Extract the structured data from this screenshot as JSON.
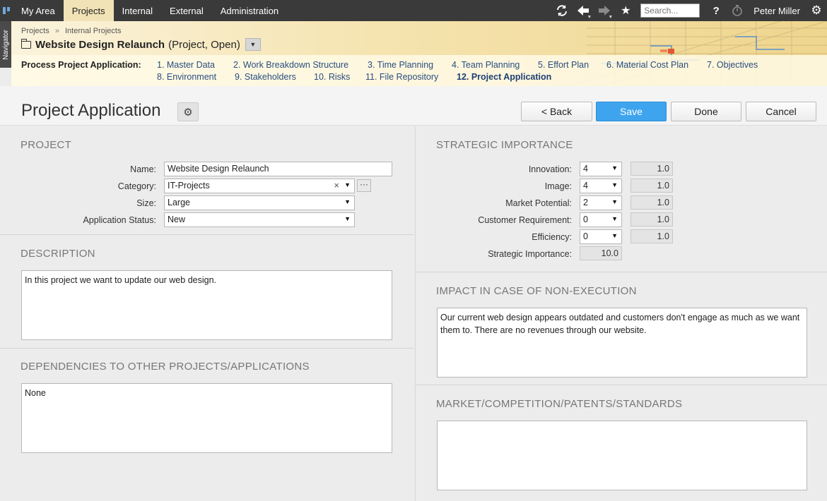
{
  "topnav": {
    "tabs": [
      {
        "label": "My Area"
      },
      {
        "label": "Projects"
      },
      {
        "label": "Internal"
      },
      {
        "label": "External"
      },
      {
        "label": "Administration"
      }
    ],
    "search_placeholder": "Search...",
    "help_label": "?",
    "user_name": "Peter Miller"
  },
  "navigator_label": "Navigator",
  "breadcrumb": {
    "items": [
      "Projects",
      "Internal Projects"
    ],
    "separator": "»"
  },
  "project": {
    "name": "Website Design Relaunch",
    "state": "(Project, Open)"
  },
  "process": {
    "label": "Process Project Application:",
    "steps": [
      {
        "label": "1. Master Data"
      },
      {
        "label": "2. Work Breakdown Structure"
      },
      {
        "label": "3. Time Planning"
      },
      {
        "label": "4. Team Planning"
      },
      {
        "label": "5. Effort Plan"
      },
      {
        "label": "6. Material Cost Plan"
      },
      {
        "label": "7. Objectives"
      },
      {
        "label": "8. Environment"
      },
      {
        "label": "9. Stakeholders"
      },
      {
        "label": "10. Risks"
      },
      {
        "label": "11. File Repository"
      },
      {
        "label": "12. Project Application"
      }
    ]
  },
  "page": {
    "title": "Project Application",
    "buttons": {
      "back": "< Back",
      "save": "Save",
      "done": "Done",
      "cancel": "Cancel"
    }
  },
  "project_section": {
    "title": "PROJECT",
    "name_label": "Name:",
    "name_value": "Website Design Relaunch",
    "category_label": "Category:",
    "category_value": "IT-Projects",
    "category_more": "···",
    "size_label": "Size:",
    "size_value": "Large",
    "status_label": "Application Status:",
    "status_value": "New"
  },
  "description": {
    "title": "DESCRIPTION",
    "text": "In this project we want to update our web design."
  },
  "dependencies": {
    "title": "DEPENDENCIES TO OTHER PROJECTS/APPLICATIONS",
    "text": "None"
  },
  "strategic": {
    "title": "STRATEGIC IMPORTANCE",
    "rows": [
      {
        "label": "Innovation:",
        "value": "4",
        "weight": "1.0"
      },
      {
        "label": "Image:",
        "value": "4",
        "weight": "1.0"
      },
      {
        "label": "Market Potential:",
        "value": "2",
        "weight": "1.0"
      },
      {
        "label": "Customer Requirement:",
        "value": "0",
        "weight": "1.0"
      },
      {
        "label": "Efficiency:",
        "value": "0",
        "weight": "1.0"
      }
    ],
    "total_label": "Strategic Importance:",
    "total_value": "10.0"
  },
  "impact": {
    "title": "IMPACT IN CASE OF NON-EXECUTION",
    "text": "Our current web design appears outdated and customers don't engage as much as we want them to. There are no revenues through our website."
  },
  "market": {
    "title": "MARKET/COMPETITION/PATENTS/STANDARDS",
    "text": ""
  },
  "colors": {
    "accent": "#3fa4ee",
    "topbar": "#3a3a3a",
    "link": "#2a4d80"
  }
}
